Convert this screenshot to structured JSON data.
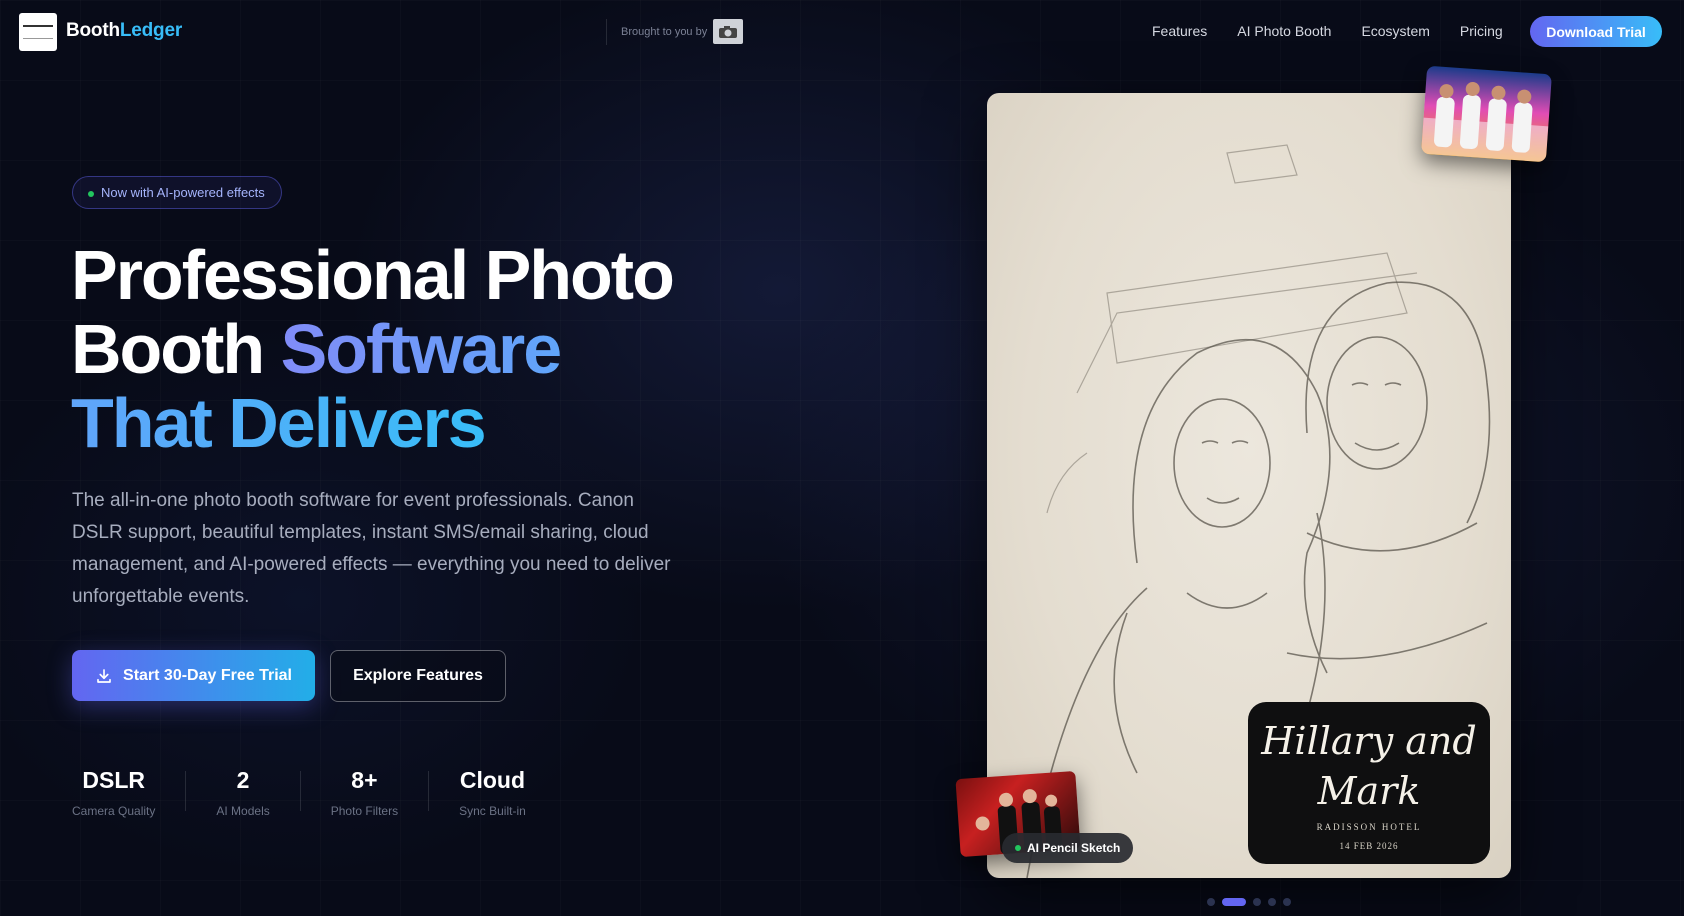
{
  "nav": {
    "brand_part1": "Booth",
    "brand_part2": "Ledger",
    "brought_by": "Brought to you by",
    "links": [
      "Features",
      "AI Photo Booth",
      "Ecosystem",
      "Pricing"
    ],
    "cta": "Download Trial"
  },
  "hero": {
    "badge": "Now with AI-powered effects",
    "headline": {
      "line1": "Professional Photo",
      "line2_plain": "Booth ",
      "line2_accent": "Software",
      "line3_accent": "That Delivers"
    },
    "subtext": "The all-in-one photo booth software for event professionals. Canon DSLR support, beautiful templates, instant SMS/email sharing, cloud management, and AI-powered effects — everything you need to deliver unforgettable events.",
    "primary_button": "Start 30-Day Free Trial",
    "secondary_button": "Explore Features",
    "stats": [
      {
        "value": "DSLR",
        "label": "Camera Quality"
      },
      {
        "value": "2",
        "label": "AI Models"
      },
      {
        "value": "8+",
        "label": "Photo Filters"
      },
      {
        "value": "Cloud",
        "label": "Sync Built-in"
      }
    ]
  },
  "showcase": {
    "names_line1": "Hillary and",
    "names_line2": "Mark",
    "venue": "RADISSON HOTEL",
    "date": "14 FEB 2026",
    "effect_tag": "AI Pencil Sketch",
    "carousel_count": 5,
    "carousel_active": 2
  },
  "colors": {
    "background": "#080b18",
    "accent_indigo": "#6366f1",
    "accent_sky": "#38bdf8",
    "status_green": "#22c55e"
  }
}
